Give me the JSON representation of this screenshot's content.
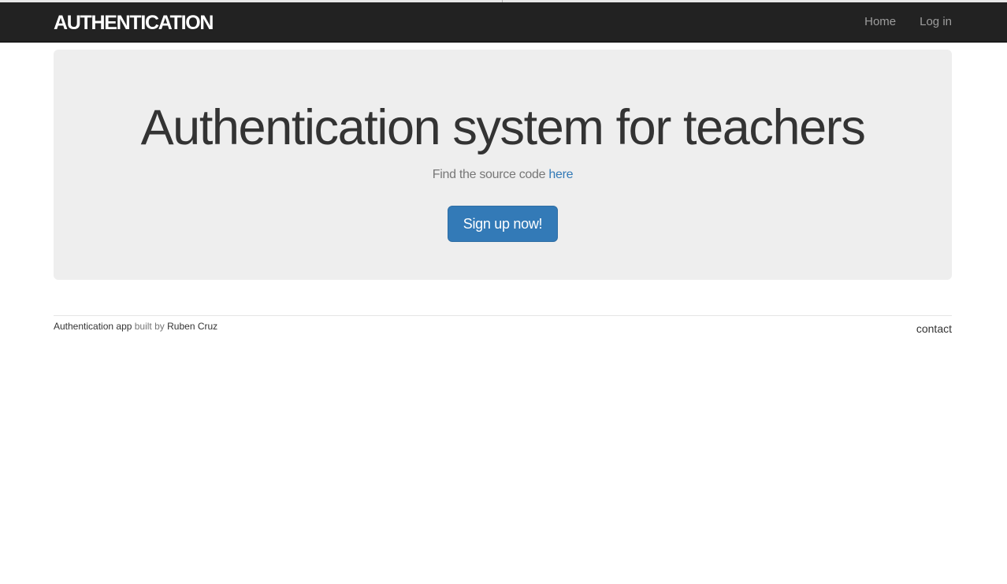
{
  "navbar": {
    "brand": "AUTHENTICATION",
    "links": [
      {
        "label": "Home"
      },
      {
        "label": "Log in"
      }
    ]
  },
  "hero": {
    "title": "Authentication system for teachers",
    "subtitle_prefix": "Find the source code ",
    "subtitle_link": "here",
    "button_label": "Sign up now!"
  },
  "footer": {
    "app_link": "Authentication app",
    "built_by_text": " built by ",
    "author_link": "Ruben Cruz",
    "contact_link": "contact"
  },
  "colors": {
    "navbar_bg": "#222222",
    "jumbotron_bg": "#eeeeee",
    "primary": "#337ab7"
  }
}
